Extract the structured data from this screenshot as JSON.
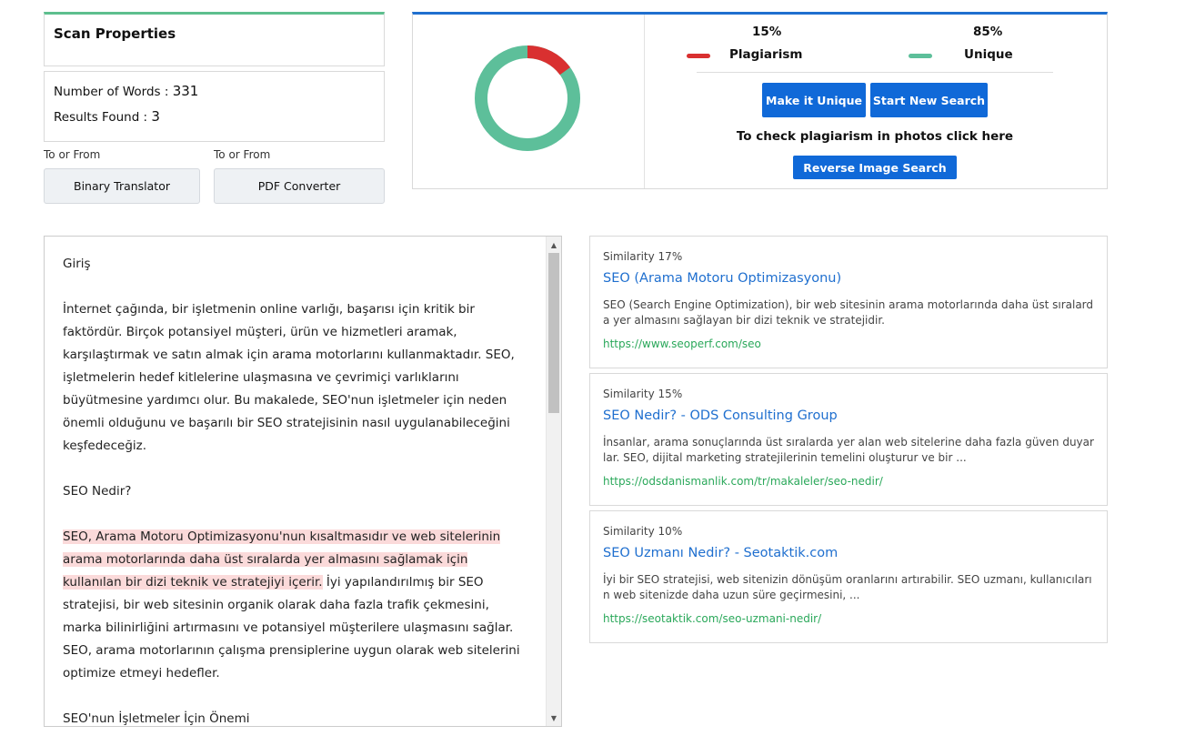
{
  "scan": {
    "title": "Scan Properties",
    "words_label": "Number of Words : ",
    "words_value": "331",
    "results_label": "Results Found : ",
    "results_value": "3"
  },
  "tools": [
    {
      "caption": "To or From",
      "label": "Binary Translator"
    },
    {
      "caption": "To or From",
      "label": "PDF Converter"
    }
  ],
  "summary": {
    "plagiarism_percent": 15,
    "unique_percent": 85,
    "plagiarism_pct_label": "15%",
    "unique_pct_label": "85%",
    "plagiarism_label": "Plagiarism",
    "unique_label": "Unique",
    "plagiarism_color": "#d93030",
    "unique_color": "#5dbf9a",
    "make_unique_label": "Make it Unique",
    "new_search_label": "Start New Search",
    "photo_note": "To check plagiarism in photos click here",
    "reverse_image_label": "Reverse Image Search"
  },
  "document": {
    "p1": "Giriş",
    "p2": "İnternet çağında, bir işletmenin online varlığı, başarısı için kritik bir faktördür. Birçok potansiyel müşteri, ürün ve hizmetleri aramak, karşılaştırmak ve satın almak için arama motorlarını kullanmaktadır. SEO, işletmelerin hedef kitlelerine ulaşmasına ve çevrimiçi varlıklarını büyütmesine yardımcı olur. Bu makalede, SEO'nun işletmeler için neden önemli olduğunu ve başarılı bir SEO stratejisinin nasıl uygulanabileceğini keşfedeceğiz.",
    "p3": "SEO Nedir?",
    "p4_highlight": "SEO, Arama Motoru Optimizasyonu'nun kısaltmasıdır ve web sitelerinin arama motorlarında daha üst sıralarda yer almasını sağlamak için kullanılan bir dizi teknik ve stratejiyi içerir.",
    "p4_rest": " İyi yapılandırılmış bir SEO stratejisi, bir web sitesinin organik olarak daha fazla trafik çekmesini, marka bilinirliğini artırmasını ve potansiyel müşterilere ulaşmasını sağlar. SEO, arama motorlarının çalışma prensiplerine uygun olarak web sitelerini optimize etmeyi hedefler.",
    "p5": "SEO'nun İşletmeler İçin Önemi"
  },
  "results": [
    {
      "similarity": "Similarity 17%",
      "title": "SEO (Arama Motoru Optimizasyonu)",
      "desc": "SEO (Search Engine Optimization), bir web sitesinin arama motorlarında daha üst sıralarda yer almasını sağlayan bir dizi teknik ve stratejidir.",
      "url": "https://www.seoperf.com/seo"
    },
    {
      "similarity": "Similarity 15%",
      "title": "SEO Nedir? - ODS Consulting Group",
      "desc": "İnsanlar, arama sonuçlarında üst sıralarda yer alan web sitelerine daha fazla güven duyarlar. SEO, dijital marketing stratejilerinin temelini oluşturur ve bir  ...",
      "url": "https://odsdanismanlik.com/tr/makaleler/seo-nedir/"
    },
    {
      "similarity": "Similarity 10%",
      "title": "SEO Uzmanı Nedir? - Seotaktik.com",
      "desc": "İyi bir SEO stratejisi, web sitenizin dönüşüm oranlarını artırabilir. SEO uzmanı, kullanıcıların web sitenizde daha uzun süre geçirmesini, ...",
      "url": "https://seotaktik.com/seo-uzmani-nedir/"
    }
  ]
}
